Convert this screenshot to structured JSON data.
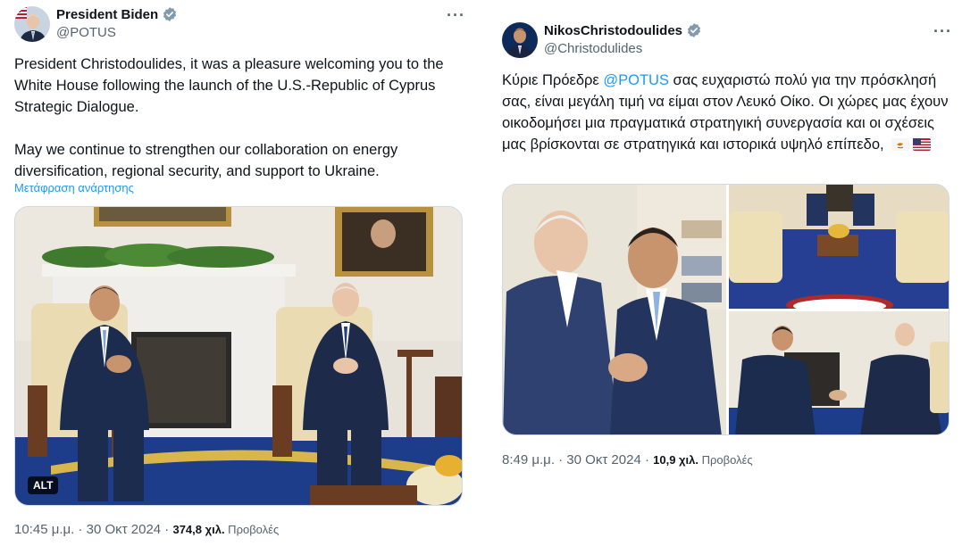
{
  "left": {
    "author": {
      "name": "President Biden",
      "handle": "@POTUS"
    },
    "text": "President Christodoulides, it was a pleasure welcoming you to the White House following the launch of the U.S.-Republic of Cyprus Strategic Dialogue.\n\nMay we continue to strengthen our collaboration on energy diversification, regional security, and support to Ukraine.",
    "translate": "Μετάφραση ανάρτησης",
    "alt": "ALT",
    "time": "10:45 μ.μ. · 30 Οκτ 2024 · ",
    "views": "374,8 χιλ.",
    "views_label": " Προβολές",
    "more": "···",
    "icons": [
      "verified-badge-icon",
      "more-options-icon"
    ]
  },
  "right": {
    "author": {
      "name": "NikosChristodoulides",
      "handle": "@Christodulides"
    },
    "text_before": "Κύριε Πρόεδρε ",
    "mention": "@POTUS",
    "text_after": " σας ευχαριστώ πολύ για την πρόσκλησή σας, είναι μεγάλη τιμή να είμαι στον Λευκό Οίκο. Οι χώρες μας έχουν οικοδομήσει μια πραγματικά στρατηγική συνεργασία και οι σχέσεις μας βρίσκονται σε στρατηγικά και ιστορικά υψηλό επίπεδο, ",
    "flags": [
      "cyprus-flag-icon",
      "us-flag-icon"
    ],
    "time": "8:49 μ.μ. · 30 Οκτ 2024 · ",
    "views": "10,9 χιλ.",
    "views_label": " Προβολές",
    "more": "···"
  },
  "colors": {
    "link": "#1d9bf0",
    "secondary": "#536471",
    "verified": "#829aab",
    "border": "#cfd9de"
  }
}
